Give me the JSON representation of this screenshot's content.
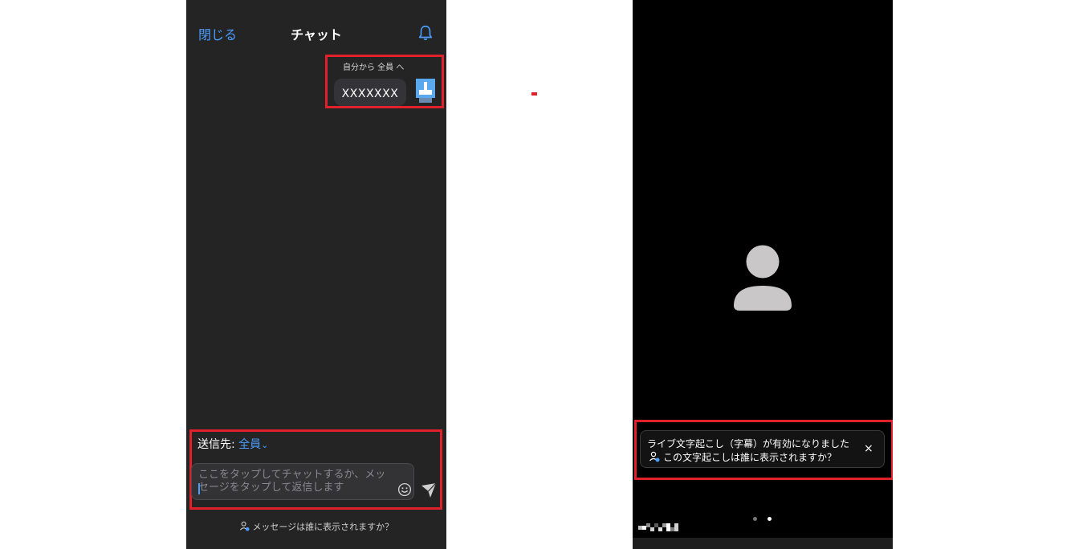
{
  "chat": {
    "close_label": "閉じる",
    "title": "チャット",
    "message_meta": "自分から 全員 へ",
    "message_text": "XXXXXXX",
    "to_label": "送信先: ",
    "to_value": "全員",
    "input_placeholder": "ここをタップしてチャットするか、メッセージをタップして返信します",
    "who_sees": "メッセージは誰に表示されますか？"
  },
  "video": {
    "caption_line1": "ライブ文字起こし（字幕）が有効になりました",
    "caption_line2": "この文字起こしは誰に表示されますか？",
    "caption_close": "×"
  },
  "icons": {
    "bell": "bell-icon",
    "emoji": "emoji-icon",
    "send": "send-icon",
    "person": "person-icon",
    "avatar": "avatar-icon"
  },
  "colors": {
    "accent": "#4a9eff",
    "highlight": "#e0212b",
    "chat_bg": "#242424",
    "video_bg": "#000000",
    "avatar_placeholder": "#c9c7c8"
  }
}
